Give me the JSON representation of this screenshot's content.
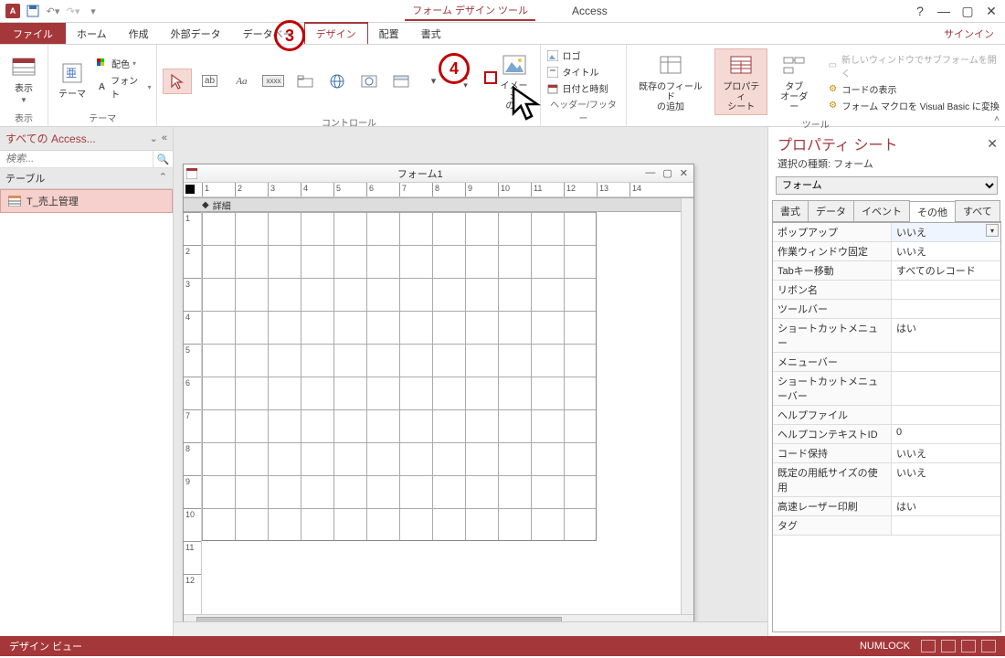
{
  "title": {
    "context": "フォーム デザイン ツール",
    "app": "Access"
  },
  "qat": {
    "save": "保存",
    "undo": "元に戻す",
    "redo": "やり直し"
  },
  "tabs": {
    "file": "ファイル",
    "home": "ホーム",
    "create": "作成",
    "external": "外部データ",
    "database": "データベー",
    "design": "デザイン",
    "arrange": "配置",
    "format": "書式",
    "signin": "サインイン"
  },
  "ribbon": {
    "views_group": "表示",
    "themes_group": "テーマ",
    "controls_group": "コントロール",
    "header_footer_group": "ヘッダー/フッター",
    "tools_group": "ツール",
    "view": "表示",
    "themes": "テーマ",
    "colors": "配色",
    "fonts": "フォント",
    "image_insert": "イメージ\nの...",
    "logo": "ロゴ",
    "title": "タイトル",
    "datetime": "日付と時刻",
    "existing_fields": "既存のフィールド\nの追加",
    "property_sheet": "プロパティ\nシート",
    "tab_order": "タブ\nオーダー",
    "subform_new": "新しいウィンドウでサブフォームを開く",
    "view_code": "コードの表示",
    "convert_macros": "フォーム マクロを Visual Basic に変換"
  },
  "nav": {
    "header": "すべての Access...",
    "search_placeholder": "検索...",
    "group_tables": "テーブル",
    "item1": "T_売上管理"
  },
  "form": {
    "title": "フォーム1",
    "detail_section": "詳細"
  },
  "props": {
    "title": "プロパティ シート",
    "subtitle": "選択の種類: フォーム",
    "combo": "フォーム",
    "tabs": {
      "format": "書式",
      "data": "データ",
      "event": "イベント",
      "other": "その他",
      "all": "すべて"
    },
    "rows": [
      {
        "k": "ポップアップ",
        "v": "いいえ",
        "dd": true
      },
      {
        "k": "作業ウィンドウ固定",
        "v": "いいえ"
      },
      {
        "k": "Tabキー移動",
        "v": "すべてのレコード"
      },
      {
        "k": "リボン名",
        "v": ""
      },
      {
        "k": "ツールバー",
        "v": ""
      },
      {
        "k": "ショートカットメニュー",
        "v": "はい"
      },
      {
        "k": "メニューバー",
        "v": ""
      },
      {
        "k": "ショートカットメニューバー",
        "v": ""
      },
      {
        "k": "ヘルプファイル",
        "v": ""
      },
      {
        "k": "ヘルプコンテキストID",
        "v": "0"
      },
      {
        "k": "コード保持",
        "v": "いいえ"
      },
      {
        "k": "既定の用紙サイズの使用",
        "v": "いいえ"
      },
      {
        "k": "高速レーザー印刷",
        "v": "はい"
      },
      {
        "k": "タグ",
        "v": ""
      }
    ]
  },
  "status": {
    "left": "デザイン ビュー",
    "numlock": "NUMLOCK"
  },
  "annotations": {
    "c3": "3",
    "c4": "4"
  }
}
